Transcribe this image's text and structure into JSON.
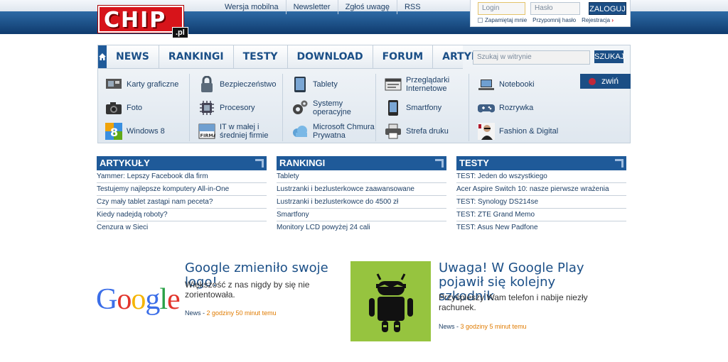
{
  "header": {
    "logo_text": "CHIP",
    "logo_suffix": ".pl",
    "top_links": [
      "Wersja mobilna",
      "Newsletter",
      "Zgłoś uwagę",
      "RSS"
    ]
  },
  "login": {
    "login_placeholder": "Login",
    "password_placeholder": "Hasło",
    "submit": "ZALOGUJ",
    "remember": "Zapamiętaj mnie",
    "forgot": "Przypomnij hasło",
    "register": "Rejestracja"
  },
  "nav": {
    "items": [
      "NEWS",
      "RANKINGI",
      "TESTY",
      "DOWNLOAD",
      "FORUM",
      "ARTYKUŁY"
    ],
    "search_placeholder": "Szukaj w witrynie",
    "search_button": "SZUKAJ",
    "collapse_label": "zwiń"
  },
  "categories": [
    {
      "label": "Karty graficzne",
      "icon": "graphics-card-icon"
    },
    {
      "label": "Bezpieczeństwo",
      "icon": "padlock-icon"
    },
    {
      "label": "Tablety",
      "icon": "tablet-icon"
    },
    {
      "label": "Przeglądarki Internetowe",
      "icon": "browser-icon"
    },
    {
      "label": "Notebooki",
      "icon": "laptop-icon"
    },
    {
      "label": "Foto",
      "icon": "camera-icon"
    },
    {
      "label": "Procesory",
      "icon": "cpu-icon"
    },
    {
      "label": "Systemy operacyjne",
      "icon": "gears-icon"
    },
    {
      "label": "Smartfony",
      "icon": "smartphone-icon"
    },
    {
      "label": "Rozrywka",
      "icon": "gamepad-icon"
    },
    {
      "label": "Windows 8",
      "icon": "windows8-icon"
    },
    {
      "label": "IT w małej i średniej firmie",
      "icon": "firma-icon"
    },
    {
      "label": "Microsoft Chmura Prywatna",
      "icon": "cloud-icon"
    },
    {
      "label": "Strefa druku",
      "icon": "printer-icon"
    },
    {
      "label": "Fashion & Digital",
      "icon": "fashion-icon"
    }
  ],
  "sections": [
    {
      "title": "ARTYKUŁY",
      "items": [
        "Yammer: Lepszy Facebook dla firm",
        "Testujemy najlepsze komputery All-in-One",
        "Czy mały tablet zastąpi nam peceta?",
        "Kiedy nadejdą roboty?",
        "Cenzura w Sieci"
      ]
    },
    {
      "title": "RANKINGI",
      "items": [
        "Tablety",
        "Lustrzanki i bezlusterkowce zaawansowane",
        "Lustrzanki i bezlusterkowce do 4500 zł",
        "Smartfony",
        "Monitory LCD powyżej 24 cali"
      ]
    },
    {
      "title": "TESTY",
      "items": [
        "TEST: Jeden do wszystkiego",
        "Acer Aspire Switch 10: nasze pierwsze wrażenia",
        "TEST: Synology DS214se",
        "TEST: ZTE Grand Memo",
        "TEST: Asus New Padfone"
      ]
    }
  ],
  "news": [
    {
      "title": "Google zmieniło swoje logo!",
      "body": "Większość z nas nigdy by się nie zorientowała.",
      "category": "News",
      "time": "2 godziny 50 minut temu",
      "image_text": "Google"
    },
    {
      "title": "Uwaga! W Google Play pojawił się kolejny szkodnik",
      "body": "Przyśpieszy Wam telefon i nabije niezły rachunek.",
      "category": "News",
      "time": "3 godziny 5 minut temu"
    }
  ],
  "colors": {
    "brand_red": "#d7141a",
    "nav_blue": "#1f5a99",
    "link_blue": "#1d3f66",
    "android_green": "#96c43f",
    "meta_orange": "#e07b00"
  }
}
